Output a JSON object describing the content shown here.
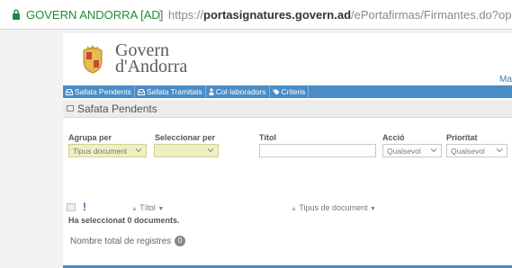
{
  "browser": {
    "site_identity": "GOVERN ANDORRA [AD]",
    "url_prefix": "https://",
    "url_host": "portasignatures.govern.ad",
    "url_path": "/ePortafirmas/Firmantes.do?operacion=listaP"
  },
  "header": {
    "brand_line1": "Govern",
    "brand_line2": "d'Andorra",
    "user_link": "Ma"
  },
  "nav": {
    "tabs": [
      {
        "label": "Safata Pendents",
        "icon": "inbox-icon"
      },
      {
        "label": "Safata Tramitats",
        "icon": "inbox-icon"
      },
      {
        "label": "Col·laboradors",
        "icon": "person-icon"
      },
      {
        "label": "Criteris",
        "icon": "tag-icon"
      }
    ]
  },
  "section": {
    "title": "Safata Pendents"
  },
  "filters": {
    "group_label": "Agrupa per",
    "group_value": "Tipus document",
    "select_label": "Seleccionar per",
    "select_value": "",
    "title_label": "Títol",
    "title_value": "",
    "action_label": "Acció",
    "action_value": "Qualsevol",
    "priority_label": "Prioritat",
    "priority_value": "Qualsevol"
  },
  "table": {
    "priority_header": "!",
    "title_header": "Títol",
    "doctype_header": "Tipus de document"
  },
  "status": {
    "selected_text": "Ha seleccionat 0 documents.",
    "total_label": "Nombre total de registres",
    "total_count": "0"
  },
  "colors": {
    "accent": "#4a8dc6",
    "secure_green": "#1f8a3a",
    "filter_bg": "#eef0c0"
  }
}
